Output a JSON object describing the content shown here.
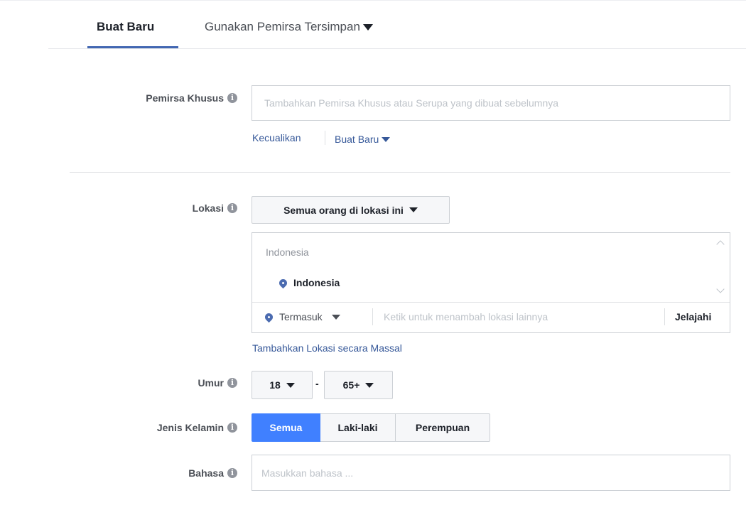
{
  "tabs": {
    "create_new": "Buat Baru",
    "use_saved": "Gunakan Pemirsa Tersimpan"
  },
  "custom_audience": {
    "label": "Pemirsa Khusus",
    "placeholder": "Tambahkan Pemirsa Khusus atau Serupa yang dibuat sebelumnya",
    "exclude_link": "Kecualikan",
    "create_new_link": "Buat Baru"
  },
  "location": {
    "label": "Lokasi",
    "scope_dropdown": "Semua orang di lokasi ini",
    "group_header": "Indonesia",
    "selected_item": "Indonesia",
    "include_dropdown": "Termasuk",
    "search_placeholder": "Ketik untuk menambah lokasi lainnya",
    "browse_button": "Jelajahi",
    "bulk_add_link": "Tambahkan Lokasi secara Massal"
  },
  "age": {
    "label": "Umur",
    "min": "18",
    "separator": "-",
    "max": "65+"
  },
  "gender": {
    "label": "Jenis Kelamin",
    "options": [
      "Semua",
      "Laki-laki",
      "Perempuan"
    ],
    "selected": "Semua"
  },
  "language": {
    "label": "Bahasa",
    "placeholder": "Masukkan bahasa ..."
  },
  "colors": {
    "accent": "#4267b2",
    "selected_button": "#4080ff",
    "link": "#365899"
  },
  "icons": {
    "info": "info-icon",
    "caret": "caret-down-icon",
    "pin": "location-pin-icon"
  }
}
